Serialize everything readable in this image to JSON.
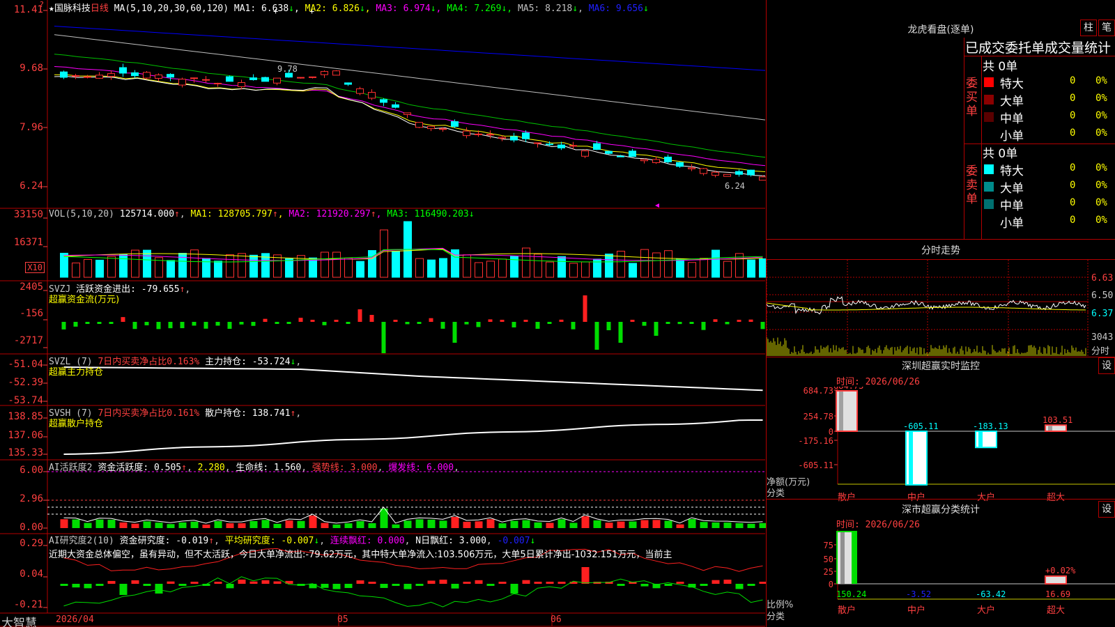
{
  "main_chart": {
    "star": "★",
    "stock_name": "国脉科技",
    "period": "日线",
    "ma_label": "MA(5,10,20,30,60,120)",
    "ma": [
      {
        "label": "MA1:",
        "value": "6.638",
        "arrow": "↓",
        "color": "#ffffff"
      },
      {
        "label": "MA2:",
        "value": "6.826",
        "arrow": "↓",
        "color": "#ffff00"
      },
      {
        "label": "MA3:",
        "value": "6.974",
        "arrow": "↓",
        "color": "#ff00ff"
      },
      {
        "label": "MA4:",
        "value": "7.269",
        "arrow": "↓",
        "color": "#00ff00"
      },
      {
        "label": "MA5:",
        "value": "8.218",
        "arrow": "↓",
        "color": "#c0c0c0"
      },
      {
        "label": "MA6:",
        "value": "9.656",
        "arrow": "↓",
        "color": "#0000ff"
      }
    ],
    "y_ticks": [
      "11.41",
      "9.68",
      "7.96",
      "6.24"
    ],
    "high_label": "9.78",
    "low_label": "6.24",
    "corner_mark": "?"
  },
  "volume": {
    "label": "VOL(5,10,20)",
    "value": "125714.000",
    "ma": [
      {
        "label": "MA1:",
        "value": "128705.797",
        "arrow": "↑",
        "color": "#ffff00"
      },
      {
        "label": "MA2:",
        "value": "121920.297",
        "arrow": "↑",
        "color": "#ff00ff"
      },
      {
        "label": "MA3:",
        "value": "116490.203",
        "arrow": "↓",
        "color": "#00ff00"
      }
    ],
    "y_ticks": [
      "33150",
      "16371"
    ],
    "unit": "X10"
  },
  "svzj": {
    "label": "SVZJ",
    "desc": "活跃资金进出:",
    "value": "-79.655",
    "arrow": "↑",
    "sub": "超赢资金流(万元)",
    "y_ticks": [
      "2405",
      "-156",
      "-2717"
    ]
  },
  "svzl": {
    "label": "SVZL (7)",
    "desc": "7日内买卖净占比0.163%",
    "desc2": "主力持仓:",
    "value": "-53.724",
    "arrow": "↓",
    "sub": "超赢主力持仓",
    "y_ticks": [
      "-51.04",
      "-52.39",
      "-53.74"
    ]
  },
  "svsh": {
    "label": "SVSH (7)",
    "desc": "7日内买卖净占比0.161%",
    "desc2": "散户持仓:",
    "value": "138.741",
    "arrow": "↑",
    "sub": "超赢散户持仓",
    "y_ticks": [
      "138.85",
      "137.06",
      "135.33"
    ]
  },
  "ai_active": {
    "label": "AI活跃度2",
    "desc": "资金活跃度:",
    "value": "0.505",
    "arrow": "↑",
    "v2": "2.280",
    "desc3": "生命线:",
    "v3": "1.560",
    "desc4": "强势线:",
    "v4": "3.000",
    "desc5": "爆发线:",
    "v5": "6.000",
    "y_ticks": [
      "6.00",
      "2.96",
      "0.00"
    ]
  },
  "ai_research": {
    "label": "AI研究度2(10)",
    "desc": "资金研究度:",
    "value": "-0.019",
    "arrow": "↑",
    "desc2": "平均研究度:",
    "v2": "-0.007",
    "desc3": "连续飘红:",
    "v3": "0.000",
    "desc4": "N日飘红:",
    "v4": "3.000",
    "v5": "-0.007",
    "comment": "近期大资金总体偏空，虽有异动，但不太活跃，今日大单净流出:-79.62万元，其中特大单净流入:103.506万元，大单5日累计净出-1032.151万元，当前主",
    "y_ticks": [
      "0.29",
      "0.04",
      "-0.21"
    ]
  },
  "footer": {
    "brand": "大智慧",
    "dates": [
      "2026/04",
      "05",
      "06"
    ]
  },
  "dragon": {
    "title": "龙虎看盘(逐单)",
    "btn1": "柱",
    "btn2": "笔",
    "header": "已成交委托单成交量统计",
    "buy_side_label": "委买单",
    "sell_side_label": "委卖单",
    "buy_total": "共 0单",
    "sell_total": "共 0单",
    "buy_rows": [
      {
        "label": "特大",
        "count": "0",
        "pct": "0%",
        "color": "#ff0000"
      },
      {
        "label": "大单",
        "count": "0",
        "pct": "0%",
        "color": "#8b0000"
      },
      {
        "label": "中单",
        "count": "0",
        "pct": "0%",
        "color": "#5a0000"
      },
      {
        "label": "小单",
        "count": "0",
        "pct": "0%",
        "color": "#000000"
      }
    ],
    "sell_rows": [
      {
        "label": "特大",
        "count": "0",
        "pct": "0%",
        "color": "#00ffff"
      },
      {
        "label": "大单",
        "count": "0",
        "pct": "0%",
        "color": "#008b8b"
      },
      {
        "label": "中单",
        "count": "0",
        "pct": "0%",
        "color": "#007070"
      },
      {
        "label": "小单",
        "count": "0",
        "pct": "0%",
        "color": "#000000"
      }
    ]
  },
  "intraday": {
    "title": "分时走势",
    "prices": [
      "6.63",
      "6.50",
      "6.37"
    ],
    "vol_tick": "3043",
    "vol_unit": "分时"
  },
  "monitor": {
    "title": "深圳超赢实时监控",
    "btn": "设",
    "time": "时间: 2026/06/26",
    "y_ticks": [
      "684.73",
      "254.78",
      "0",
      "-175.16",
      "-605.11"
    ],
    "y_label": "净额(万元)",
    "x_label": "分类",
    "categories": [
      "散户",
      "中户",
      "大户",
      "超大"
    ],
    "values": [
      684.73,
      -605.11,
      -183.13,
      103.51
    ],
    "value_labels": [
      "684.73",
      "-605.11",
      "-183.13",
      "103.51"
    ]
  },
  "classify": {
    "title": "深市超赢分类统计",
    "btn": "设",
    "time": "时间: 2026/06/26",
    "y_ticks": [
      "75",
      "50",
      "25",
      "0"
    ],
    "y_label": "比例%",
    "x_label": "分类",
    "categories": [
      "散户",
      "中户",
      "大户",
      "超大"
    ],
    "bottom_values": [
      "150.24",
      "-3.52",
      "-63.42",
      "16.69"
    ],
    "top_label": "+0.02%"
  }
}
